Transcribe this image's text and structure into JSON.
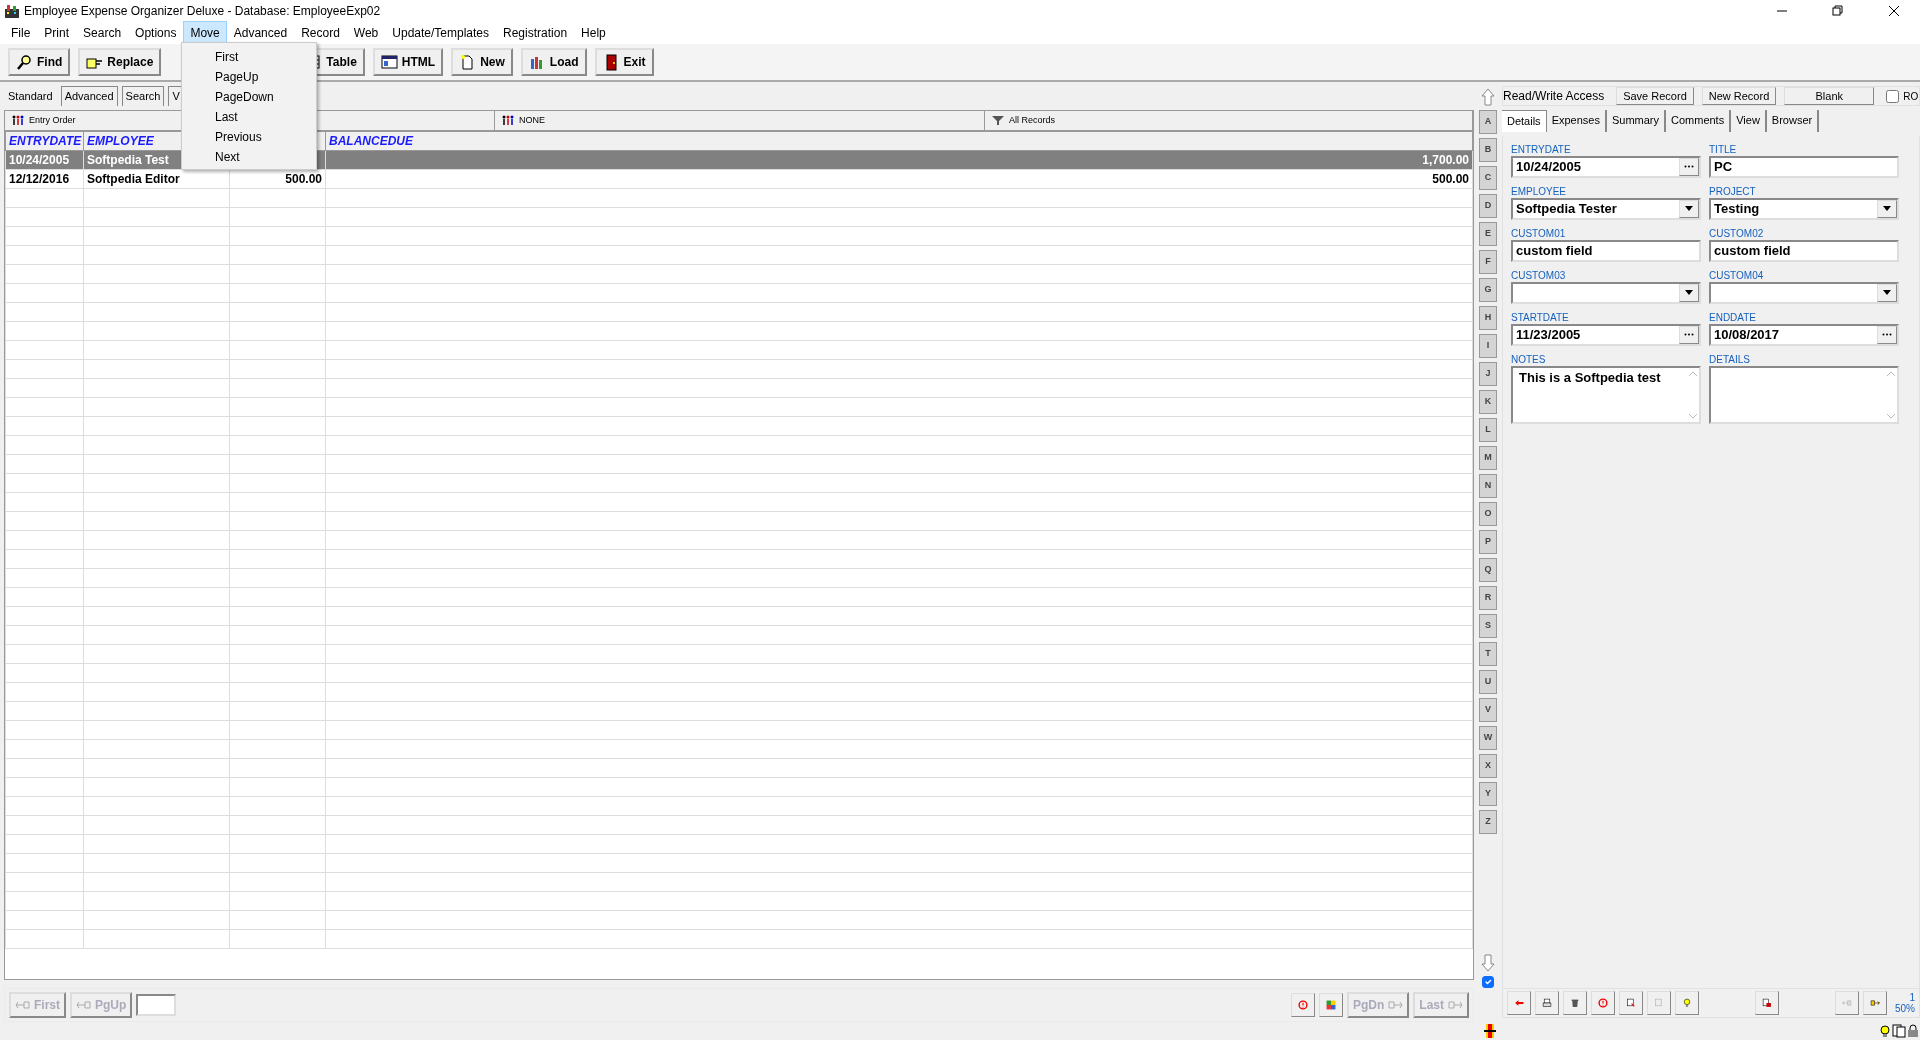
{
  "window": {
    "title": "Employee Expense Organizer Deluxe - Database: EmployeeExp02"
  },
  "menu": [
    {
      "label": "File",
      "selected": false
    },
    {
      "label": "Print",
      "selected": false
    },
    {
      "label": "Search",
      "selected": false
    },
    {
      "label": "Options",
      "selected": false
    },
    {
      "label": "Move",
      "selected": true
    },
    {
      "label": "Advanced",
      "selected": false
    },
    {
      "label": "Record",
      "selected": false
    },
    {
      "label": "Web",
      "selected": false
    },
    {
      "label": "Update/Templates",
      "selected": false
    },
    {
      "label": "Registration",
      "selected": false
    },
    {
      "label": "Help",
      "selected": false
    }
  ],
  "open_menu": {
    "items": [
      "First",
      "PageUp",
      "PageDown",
      "Last",
      "Previous",
      "Next"
    ]
  },
  "toolbar": [
    {
      "label": "Find",
      "kind": "find"
    },
    {
      "label": "Replace",
      "kind": "replace"
    },
    {
      "label": "Table",
      "kind": "table"
    },
    {
      "label": "HTML",
      "kind": "html"
    },
    {
      "label": "New",
      "kind": "new"
    },
    {
      "label": "Load",
      "kind": "load"
    },
    {
      "label": "Exit",
      "kind": "exit"
    }
  ],
  "view_tabs": [
    {
      "label": "Standard",
      "selected": true
    },
    {
      "label": "Advanced",
      "selected": false
    },
    {
      "label": "Search",
      "selected": false
    },
    {
      "label": "V",
      "selected": false
    }
  ],
  "filters": [
    "Entry Order",
    "NONE",
    "All Records"
  ],
  "table": {
    "columns": [
      "ENTRYDATE",
      "EMPLOYEE",
      "",
      "BALANCEDUE"
    ],
    "rows": [
      {
        "cells": [
          "10/24/2005",
          "Softpedia Test",
          "",
          "1,700.00"
        ],
        "selected": true
      },
      {
        "cells": [
          "12/12/2016",
          "Softpedia Editor",
          "500.00",
          "500.00"
        ],
        "selected": false
      }
    ]
  },
  "alphabet": [
    "A",
    "B",
    "C",
    "D",
    "E",
    "F",
    "G",
    "H",
    "I",
    "J",
    "K",
    "L",
    "M",
    "N",
    "O",
    "P",
    "Q",
    "R",
    "S",
    "T",
    "U",
    "V",
    "W",
    "X",
    "Y",
    "Z"
  ],
  "alphabet_checkbox": {
    "checked": true
  },
  "record_panel": {
    "access": "Read/Write Access",
    "buttons": [
      "Save Record",
      "New Record",
      "Blank"
    ],
    "ro": {
      "label": "RO",
      "checked": false
    },
    "tabs": [
      {
        "label": "Details",
        "selected": true
      },
      {
        "label": "Expenses",
        "selected": false
      },
      {
        "label": "Summary",
        "selected": false
      },
      {
        "label": "Comments",
        "selected": false
      },
      {
        "label": "View",
        "selected": false
      },
      {
        "label": "Browser",
        "selected": false
      }
    ],
    "fields": [
      {
        "label": "ENTRYDATE",
        "value": "10/24/2005",
        "kind": "date"
      },
      {
        "label": "TITLE",
        "value": "PC",
        "kind": "text"
      },
      {
        "label": "EMPLOYEE",
        "value": "Softpedia Tester",
        "kind": "select"
      },
      {
        "label": "PROJECT",
        "value": "Testing",
        "kind": "select"
      },
      {
        "label": "CUSTOM01",
        "value": "custom field",
        "kind": "text"
      },
      {
        "label": "CUSTOM02",
        "value": "custom field",
        "kind": "text"
      },
      {
        "label": "CUSTOM03",
        "kind": "select"
      },
      {
        "label": "CUSTOM04",
        "kind": "select"
      },
      {
        "label": "STARTDATE",
        "value": "11/23/2005",
        "kind": "date"
      },
      {
        "label": "ENDDATE",
        "value": "10/08/2017",
        "kind": "date"
      },
      {
        "label": "NOTES",
        "value": "This is a Softpedia test",
        "kind": "textarea"
      },
      {
        "label": "DETAILS",
        "kind": "textarea"
      }
    ]
  },
  "bottom_nav": [
    {
      "label": "First",
      "disabled": true
    },
    {
      "label": "PgUp",
      "disabled": true
    }
  ],
  "bottom_nav_right": [
    {
      "label": "PgDn",
      "disabled": true
    },
    {
      "label": "Last",
      "disabled": true
    }
  ],
  "zoom": {
    "record": "1",
    "percent": "50%"
  }
}
